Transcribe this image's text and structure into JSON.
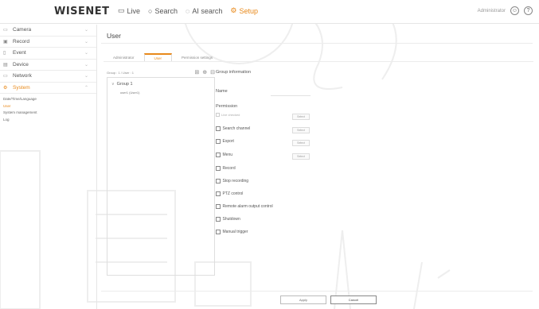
{
  "app": {
    "logo": "WISENET",
    "nav": [
      {
        "label": "Live",
        "icon": "monitor-icon"
      },
      {
        "label": "Search",
        "icon": "search-icon"
      },
      {
        "label": "AI search",
        "icon": "ai-search-icon"
      },
      {
        "label": "Setup",
        "icon": "setup-icon",
        "active": true
      }
    ],
    "user_label": "Administrator",
    "accent": "#e8891a"
  },
  "sidebar": {
    "items": [
      {
        "label": "Camera",
        "icon": "camera-icon"
      },
      {
        "label": "Record",
        "icon": "record-icon"
      },
      {
        "label": "Event",
        "icon": "event-icon"
      },
      {
        "label": "Device",
        "icon": "device-icon"
      },
      {
        "label": "Network",
        "icon": "network-icon"
      },
      {
        "label": "System",
        "icon": "system-icon",
        "active": true
      }
    ],
    "subitems": [
      {
        "label": "Date/Time/Language"
      },
      {
        "label": "User",
        "active": true
      },
      {
        "label": "System management"
      },
      {
        "label": "Log"
      }
    ]
  },
  "page": {
    "title": "User",
    "tabs": [
      {
        "label": "Administrator"
      },
      {
        "label": "User",
        "active": true
      },
      {
        "label": "Permission settings"
      }
    ]
  },
  "tree": {
    "count": "Group : 1 / User : 1",
    "group": "Group 1",
    "user": "user1 (User1)"
  },
  "group_info": {
    "title": "Group information",
    "name_label": "Name",
    "permission_label": "Permission",
    "live_checked": "Live checked",
    "permissions": [
      {
        "label": "Search channel",
        "button": "Select"
      },
      {
        "label": "Export",
        "button": "Select"
      },
      {
        "label": "Menu",
        "button": "Select"
      },
      {
        "label": "Record"
      },
      {
        "label": "Stop recording"
      },
      {
        "label": "PTZ control"
      },
      {
        "label": "Remote alarm output control"
      },
      {
        "label": "Shutdown"
      },
      {
        "label": "Manual trigger"
      }
    ],
    "live_button": "Select"
  },
  "footer": {
    "apply": "Apply",
    "cancel": "Cancel"
  }
}
